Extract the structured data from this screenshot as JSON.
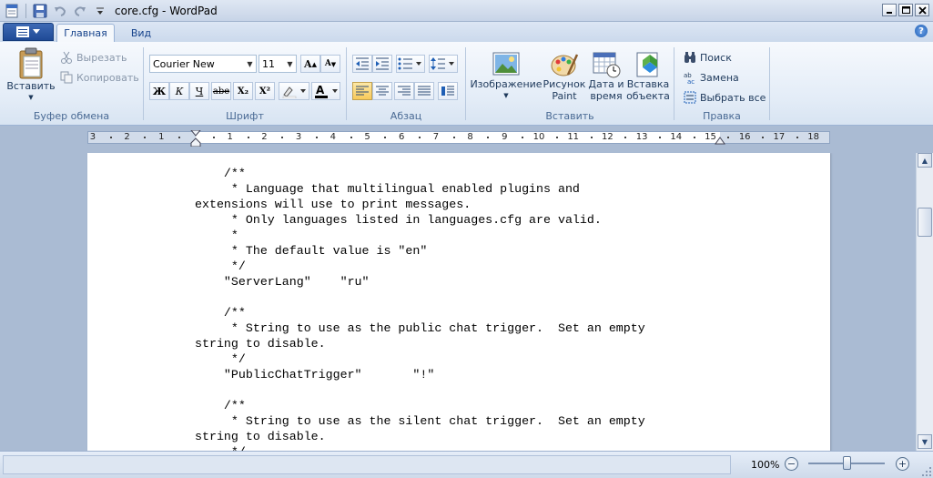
{
  "window": {
    "title": "core.cfg - WordPad"
  },
  "tabs": [
    {
      "label": "Главная"
    },
    {
      "label": "Вид"
    }
  ],
  "ribbon": {
    "clipboard": {
      "label": "Буфер обмена",
      "paste": "Вставить",
      "cut": "Вырезать",
      "copy": "Копировать"
    },
    "font": {
      "label": "Шрифт",
      "family": "Courier New",
      "size": "11",
      "bold": "Ж",
      "italic": "К",
      "underline": "Ч",
      "strike": "abe",
      "sub": "X₂",
      "sup": "X²"
    },
    "paragraph": {
      "label": "Абзац"
    },
    "insert": {
      "label": "Вставить",
      "picture": "Изображение",
      "paint_line1": "Рисунок",
      "paint_line2": "Paint",
      "datetime_line1": "Дата и",
      "datetime_line2": "время",
      "object_line1": "Вставка",
      "object_line2": "объекта"
    },
    "edit": {
      "label": "Правка",
      "find": "Поиск",
      "replace": "Замена",
      "select_all": "Выбрать все"
    }
  },
  "ruler": {
    "labels": [
      "3",
      "2",
      "1",
      "1",
      "2",
      "3",
      "4",
      "5",
      "6",
      "7",
      "8",
      "9",
      "10",
      "11",
      "12",
      "13",
      "14",
      "15",
      "16",
      "17",
      "18"
    ]
  },
  "document": {
    "lines": [
      "    /**",
      "     * Language that multilingual enabled plugins and",
      "extensions will use to print messages.",
      "     * Only languages listed in languages.cfg are valid.",
      "     *",
      "     * The default value is \"en\"",
      "     */",
      "    \"ServerLang\"    \"ru\"",
      "",
      "    /**",
      "     * String to use as the public chat trigger.  Set an empty",
      "string to disable.",
      "     */",
      "    \"PublicChatTrigger\"       \"!\"",
      "",
      "    /**",
      "     * String to use as the silent chat trigger.  Set an empty",
      "string to disable.",
      "     */"
    ]
  },
  "status": {
    "zoom": "100%"
  },
  "colors": {
    "accent": "#1f4a96",
    "ribbon": "#e3ecf7",
    "workspace": "#aabbd3"
  }
}
